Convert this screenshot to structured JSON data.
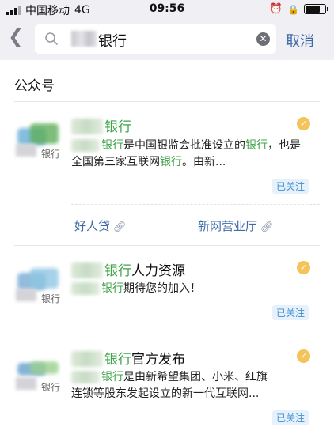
{
  "status_bar": {
    "carrier": "中国移动",
    "network": "4G",
    "time": "09:56",
    "icons": [
      "signal-icon",
      "alarm-icon",
      "lock-icon",
      "battery-icon"
    ]
  },
  "search": {
    "query": "银行",
    "cancel_label": "取消"
  },
  "section": {
    "title": "公众号"
  },
  "results": [
    {
      "name_suffix": "银行",
      "logo_text": "银行",
      "desc_parts": [
        "银行",
        "是中国银监会批准设立的",
        "银行",
        "，也是全国第三家互联网",
        "银行",
        "。由新..."
      ],
      "followed": "已关注",
      "menus": [
        {
          "label": "好人贷"
        },
        {
          "label": "新网营业厅"
        }
      ]
    },
    {
      "name_green": "银行",
      "name_suffix": "人力资源",
      "logo_text": "银行",
      "desc_parts": [
        "银行",
        "期待您的加入！"
      ],
      "followed": "已关注"
    },
    {
      "name_green": "银行",
      "name_suffix": "官方发布",
      "logo_text": "银行",
      "desc_parts": [
        "银行",
        "是由新希望集团、小米、红旗",
        "连锁等股东发起设立的新一代互联网..."
      ],
      "followed": "已关注"
    }
  ],
  "colors": {
    "keyword_green": "#3fa34a",
    "link_blue": "#3f6aa9",
    "verified_badge": "#f4c35a",
    "followed_text": "#3f8fd0"
  }
}
